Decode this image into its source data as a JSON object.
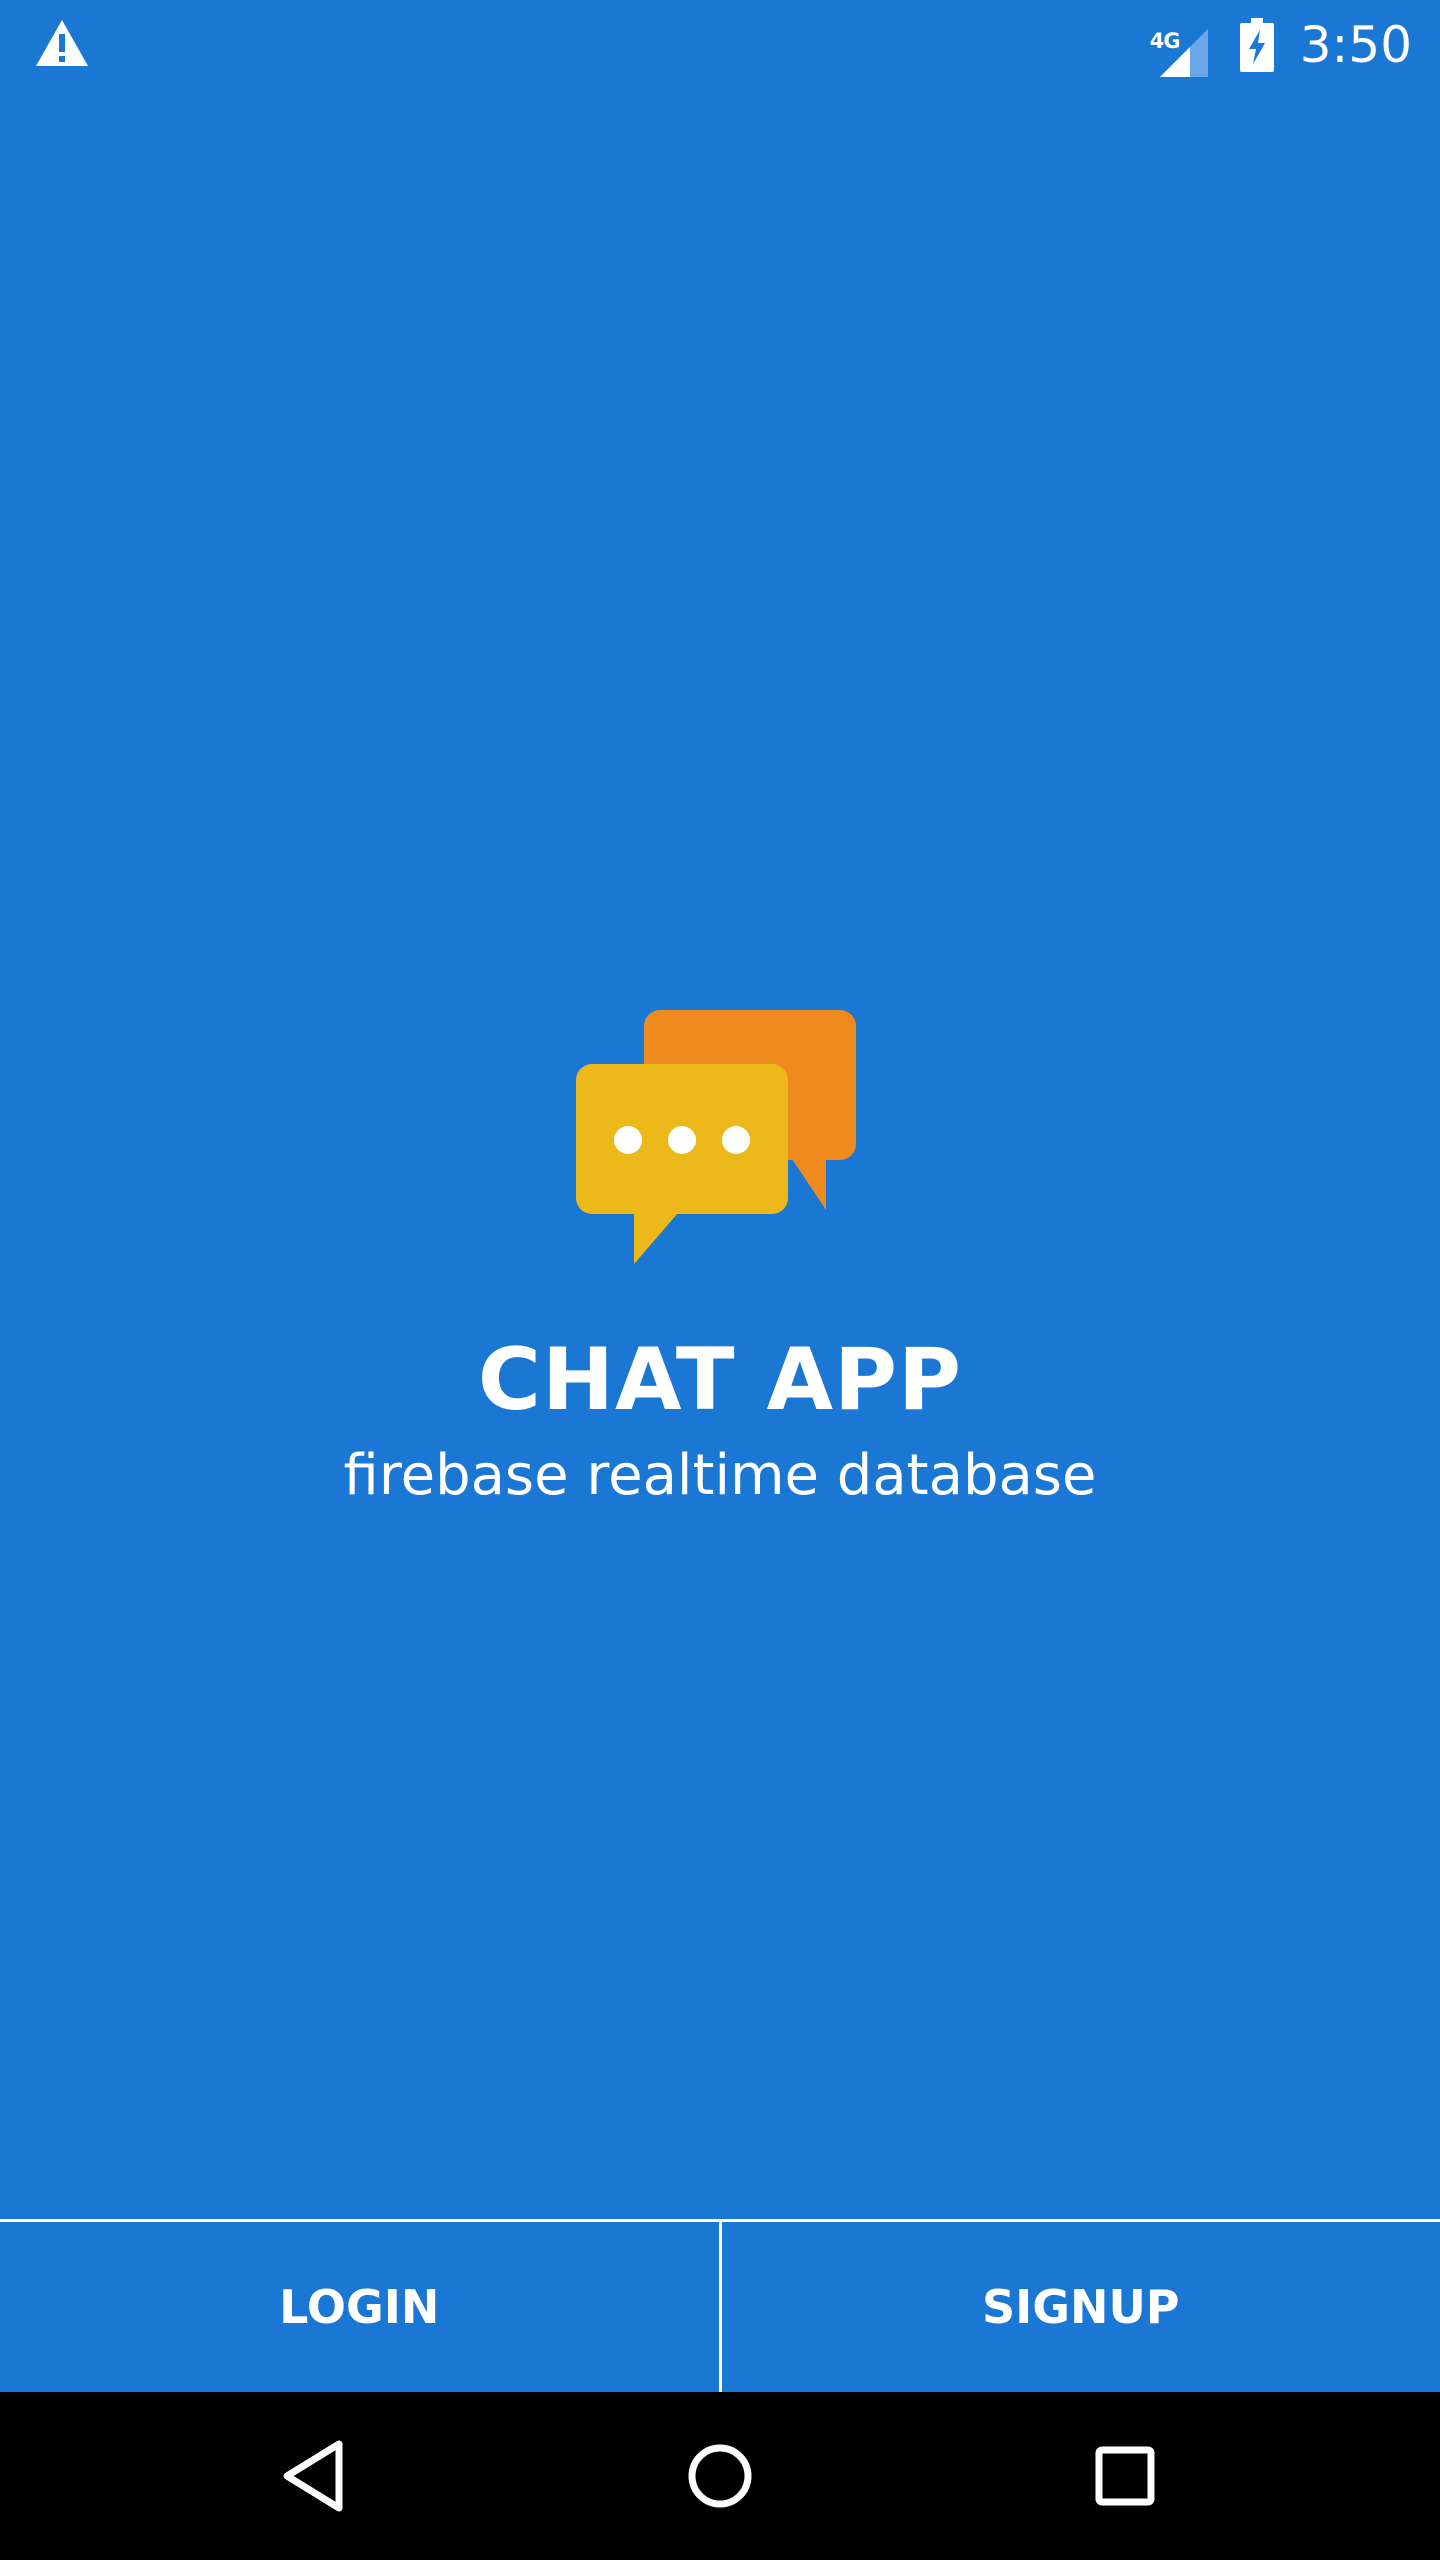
{
  "status_bar": {
    "network_label": "4G",
    "time": "3:50",
    "icons": [
      "warning-icon",
      "signal-icon",
      "battery-charging-icon"
    ]
  },
  "splash": {
    "title": "CHAT APP",
    "subtitle": "firebase realtime database",
    "logo_icon": "chat-bubbles-icon",
    "logo_colors": {
      "back_bubble": "#ef8a1f",
      "front_bubble": "#ecb81a",
      "dots": "#ffffff"
    }
  },
  "actions": {
    "login_label": "LOGIN",
    "signup_label": "SIGNUP"
  },
  "navigation": {
    "icons": [
      "back-icon",
      "home-icon",
      "recents-icon"
    ]
  },
  "colors": {
    "background": "#1a77d4",
    "text": "#ffffff",
    "nav_bar": "#000000"
  }
}
